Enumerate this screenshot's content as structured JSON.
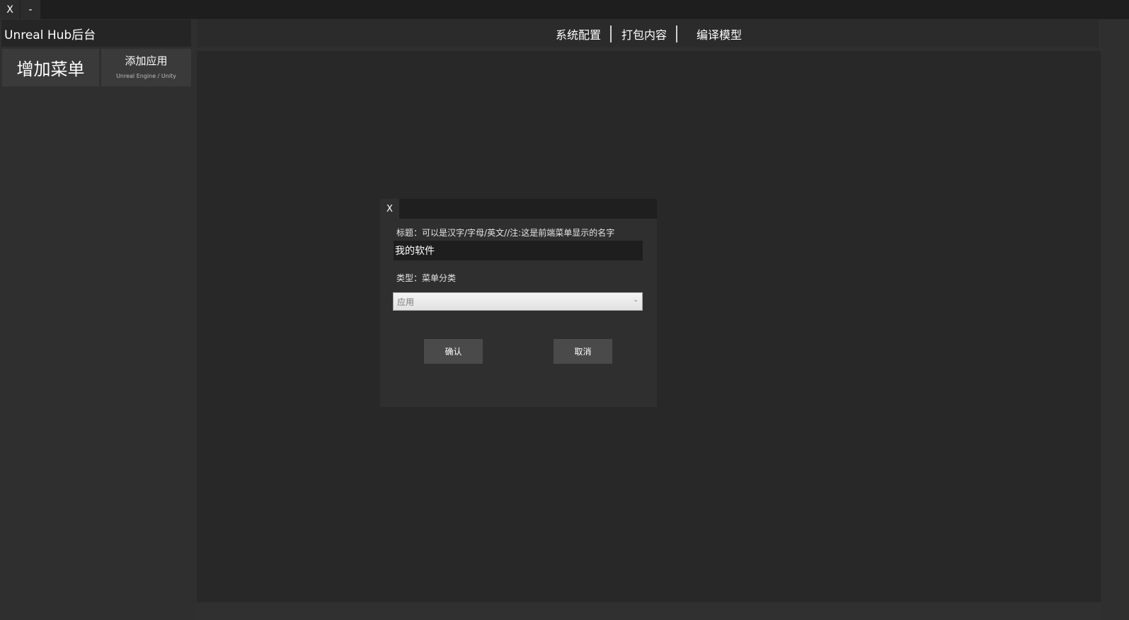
{
  "window": {
    "close_label": "X",
    "minimize_label": "-"
  },
  "sidebar": {
    "app_title": "Unreal Hub后台",
    "add_menu_label": "增加菜单",
    "add_app_label": "添加应用",
    "add_app_sublabel": "Unreal Engine / Unity"
  },
  "topnav": {
    "items": [
      {
        "label": "系统配置"
      },
      {
        "label": "打包内容"
      },
      {
        "label": "编译模型"
      }
    ]
  },
  "dialog": {
    "close_label": "X",
    "title_label": "标题：可以是汉字/字母/英文//注:这是前端菜单显示的名字",
    "title_value": "我的软件",
    "type_label": "类型：菜单分类",
    "type_selected": "应用",
    "confirm_label": "确认",
    "cancel_label": "取消"
  }
}
